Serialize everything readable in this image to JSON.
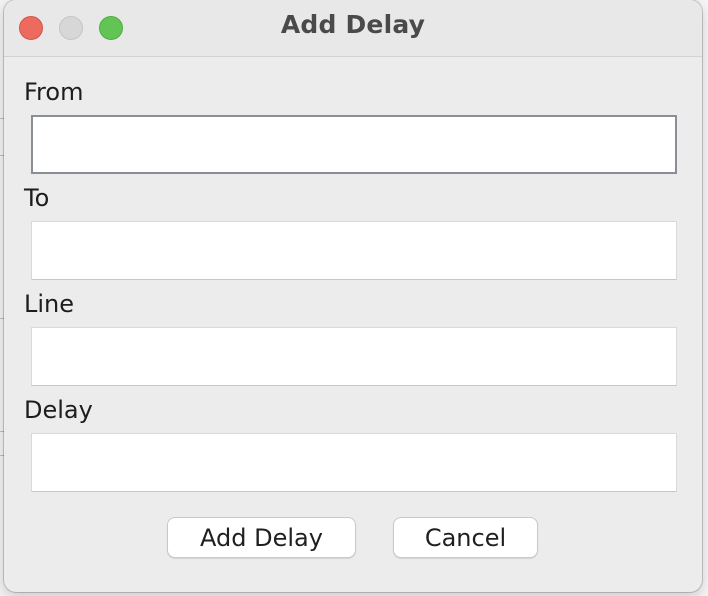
{
  "window": {
    "title": "Add Delay"
  },
  "form": {
    "fields": [
      {
        "label": "From",
        "value": "",
        "placeholder": ""
      },
      {
        "label": "To",
        "value": "",
        "placeholder": ""
      },
      {
        "label": "Line",
        "value": "",
        "placeholder": ""
      },
      {
        "label": "Delay",
        "value": "",
        "placeholder": ""
      }
    ]
  },
  "buttons": {
    "add_label": "Add Delay",
    "cancel_label": "Cancel"
  },
  "colors": {
    "close": "#ed6a5e",
    "minimize": "#d7d7d7",
    "zoom": "#61c454"
  }
}
